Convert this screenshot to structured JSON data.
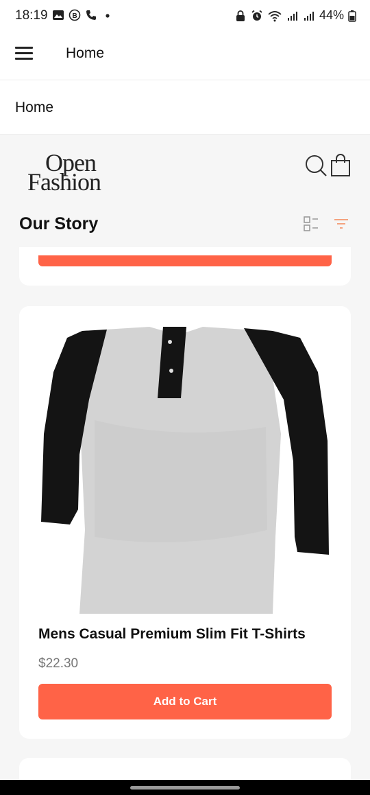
{
  "status_bar": {
    "time": "18:19",
    "battery": "44%",
    "icons": [
      "gallery-icon",
      "b-badge-icon",
      "phone-icon",
      "dot-icon",
      "lock-icon",
      "alarm-icon",
      "wifi-icon",
      "signal-icon",
      "signal-icon",
      "battery-icon"
    ]
  },
  "app_bar": {
    "title": "Home",
    "menu_icon": "hamburger-icon"
  },
  "breadcrumb": {
    "label": "Home"
  },
  "store": {
    "logo_line1": "Open",
    "logo_line2": "Fashion",
    "search_icon": "search-icon",
    "bag_icon": "shopping-bag-icon"
  },
  "section": {
    "title": "Our Story",
    "view_icon": "list-view-icon",
    "filter_icon": "filter-icon"
  },
  "product": {
    "title": "Mens Casual Premium Slim Fit T-Shirts",
    "price": "$22.30",
    "button_label": "Add to Cart"
  },
  "colors": {
    "accent": "#ff6347",
    "filter_icon": "#f4a27e",
    "price": "#777777",
    "background": "#f6f6f6"
  }
}
